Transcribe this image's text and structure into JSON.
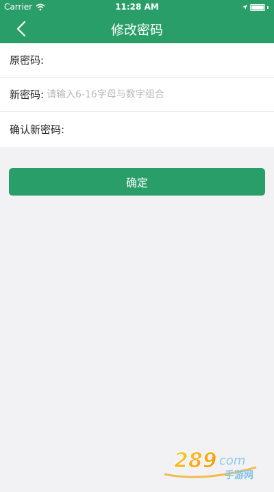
{
  "status_bar": {
    "carrier": "Carrier",
    "time": "11:28 AM",
    "battery_level": 1.0
  },
  "nav": {
    "title": "修改密码",
    "back_icon": "chevron-left-icon"
  },
  "form": {
    "fields": [
      {
        "label": "原密码:",
        "value": "",
        "placeholder": ""
      },
      {
        "label": "新密码:",
        "value": "",
        "placeholder": "请输入6-16字母与数字组合"
      },
      {
        "label": "确认新密码:",
        "value": "",
        "placeholder": ""
      }
    ]
  },
  "actions": {
    "confirm_label": "确定"
  },
  "colors": {
    "brand": "#2a9e69",
    "background": "#f2f2f4",
    "placeholder": "#b8b8b8"
  },
  "watermark": {
    "text_top": "289",
    "text_suffix": "com",
    "text_bottom": "手游网"
  }
}
